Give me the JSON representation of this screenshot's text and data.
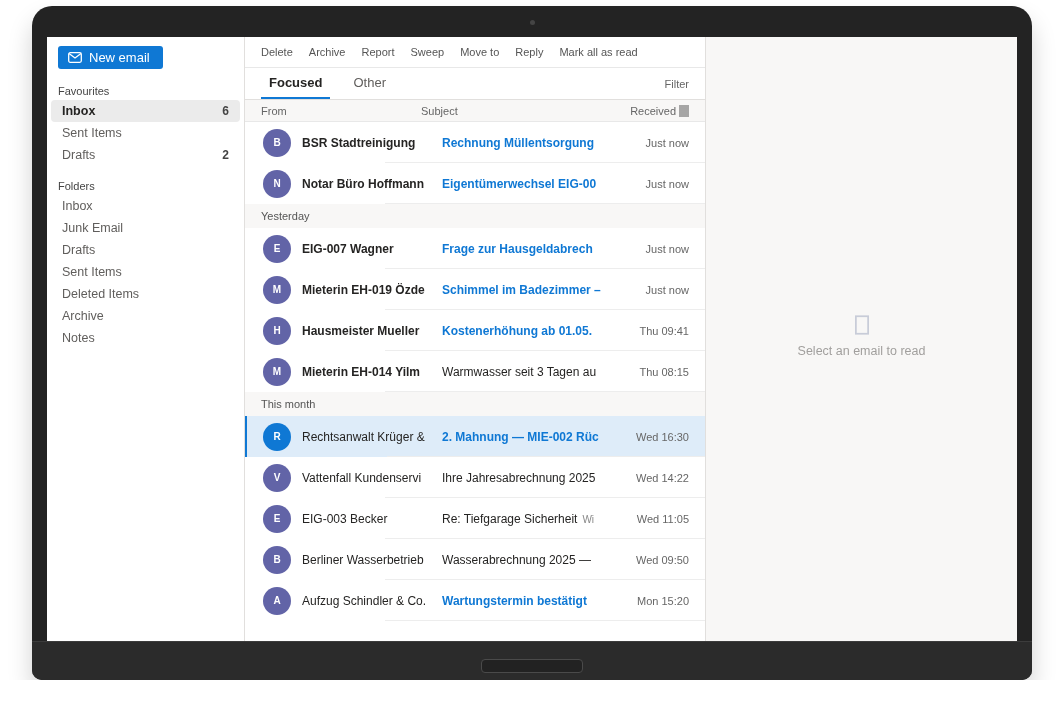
{
  "sidebar": {
    "new_email_button": "New email",
    "sections": [
      {
        "title": "Favourites",
        "items": [
          {
            "label": "Inbox",
            "count": "6",
            "selected": true
          },
          {
            "label": "Sent Items",
            "selected": false
          },
          {
            "label": "Drafts",
            "count": "2",
            "selected": false
          }
        ]
      },
      {
        "title": "Folders",
        "items": [
          {
            "label": "Inbox",
            "selected": false
          },
          {
            "label": "Junk Email",
            "selected": false
          },
          {
            "label": "Drafts",
            "selected": false
          },
          {
            "label": "Sent Items",
            "selected": false
          },
          {
            "label": "Deleted Items",
            "selected": false
          },
          {
            "label": "Archive",
            "selected": false
          },
          {
            "label": "Notes",
            "selected": false
          }
        ]
      }
    ]
  },
  "toolbar": [
    "Delete",
    "Archive",
    "Report",
    "Sweep",
    "Move to",
    "Reply",
    "Mark all as read"
  ],
  "tabs": [
    {
      "label": "Focused",
      "selected": true
    },
    {
      "label": "Other",
      "selected": false
    }
  ],
  "filter": "Filter",
  "columns": {
    "from": "From",
    "subject": "Subject",
    "received": "Received"
  },
  "groups": [
    {
      "messages": [
        {
          "initial": "B",
          "from": "BSR Stadtreinigung",
          "subject": "Rechnung Müllentsorgung",
          "received": "Just now",
          "unread": true,
          "important": true,
          "selected": false
        },
        {
          "initial": "N",
          "from": "Notar Büro Hoffmann",
          "subject": "Eigentümerwechsel EIG-00",
          "received": "Just now",
          "unread": true,
          "important": true,
          "selected": false
        }
      ]
    },
    {
      "heading": "Yesterday",
      "messages": [
        {
          "initial": "E",
          "from": "EIG-007 Wagner",
          "subject": "Frage zur Hausgeldabrech",
          "received": "Just now",
          "unread": true,
          "important": true,
          "selected": false
        },
        {
          "initial": "M",
          "from": "Mieterin EH-019 Özde",
          "subject": "Schimmel im Badezimmer –",
          "received": "Just now",
          "unread": true,
          "important": true,
          "selected": false
        },
        {
          "initial": "H",
          "from": "Hausmeister Mueller",
          "subject": "Kostenerhöhung ab 01.05.",
          "received": "Thu 09:41",
          "unread": true,
          "important": true,
          "selected": false
        },
        {
          "initial": "M",
          "from": "Mieterin EH-014 Yilm",
          "subject": "Warmwasser seit 3 Tagen au",
          "received": "Thu 08:15",
          "unread": true,
          "important": false,
          "selected": false
        }
      ]
    },
    {
      "heading": "This month",
      "messages": [
        {
          "initial": "R",
          "from": "Rechtsanwalt Krüger &",
          "subject": "2. Mahnung — MIE-002 Rüc",
          "received": "Wed 16:30",
          "unread": false,
          "important": true,
          "selected": true
        },
        {
          "initial": "V",
          "from": "Vattenfall Kundenservi",
          "subject": "Ihre Jahresabrechnung 2025",
          "received": "Wed 14:22",
          "unread": false,
          "important": false,
          "selected": false
        },
        {
          "initial": "E",
          "from": "EIG-003 Becker",
          "subject": "Re: Tiefgarage Sicherheit",
          "preview": "Wi",
          "received": "Wed 11:05",
          "unread": false,
          "important": false,
          "selected": false
        },
        {
          "initial": "B",
          "from": "Berliner Wasserbetrieb",
          "subject": "Wasserabrechnung 2025 —",
          "received": "Wed 09:50",
          "unread": false,
          "important": false,
          "selected": false
        },
        {
          "initial": "A",
          "from": "Aufzug Schindler & Co.",
          "subject": "Wartungstermin bestätigt",
          "received": "Mon 15:20",
          "unread": false,
          "important": true,
          "selected": false
        }
      ]
    }
  ],
  "reading_pane": {
    "message": "Select an email to read"
  }
}
